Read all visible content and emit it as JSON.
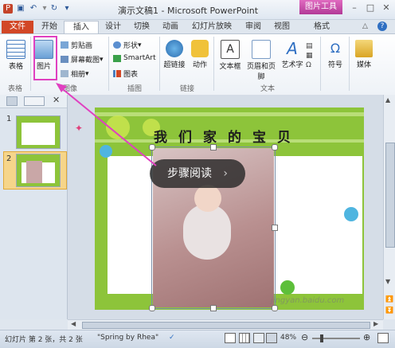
{
  "window": {
    "title": "演示文稿1 - Microsoft PowerPoint",
    "context_tab": "图片工具"
  },
  "tabs": [
    "文件",
    "开始",
    "插入",
    "设计",
    "切换",
    "动画",
    "幻灯片放映",
    "审阅",
    "视图",
    "格式"
  ],
  "ribbon": {
    "table_label": "表格",
    "image_label": "图片",
    "clipart_label": "剪贴画",
    "screenshot_label": "屏幕截图",
    "album_label": "相册",
    "shapes_label": "形状",
    "smartart_label": "SmartArt",
    "chart_label": "图表",
    "hyperlink_label": "超链接",
    "action_label": "动作",
    "textbox_label": "文本框",
    "headerfooter_label": "页眉和页脚",
    "wordart_label": "艺术字",
    "symbol_label": "符号",
    "media_label": "媒体",
    "groups": {
      "tables": "表格",
      "images": "图像",
      "illustrations": "插图",
      "links": "链接",
      "text": "文本"
    }
  },
  "slides": [
    {
      "number": "1"
    },
    {
      "number": "2"
    }
  ],
  "slide": {
    "title": "我们家的宝贝"
  },
  "tooltip": {
    "text": "步骤阅读",
    "chevron": "›"
  },
  "statusbar": {
    "slide_info": "幻灯片 第 2 张，共 2 张",
    "theme": "\"Spring by Rhea\"",
    "zoom": "48%"
  },
  "watermark": "jingyan.baidu.com",
  "colors": {
    "file_tab": "#d24726",
    "context_tab": "#b23a97",
    "annotation": "#e040c0",
    "slide_green": "#8dc43a"
  }
}
